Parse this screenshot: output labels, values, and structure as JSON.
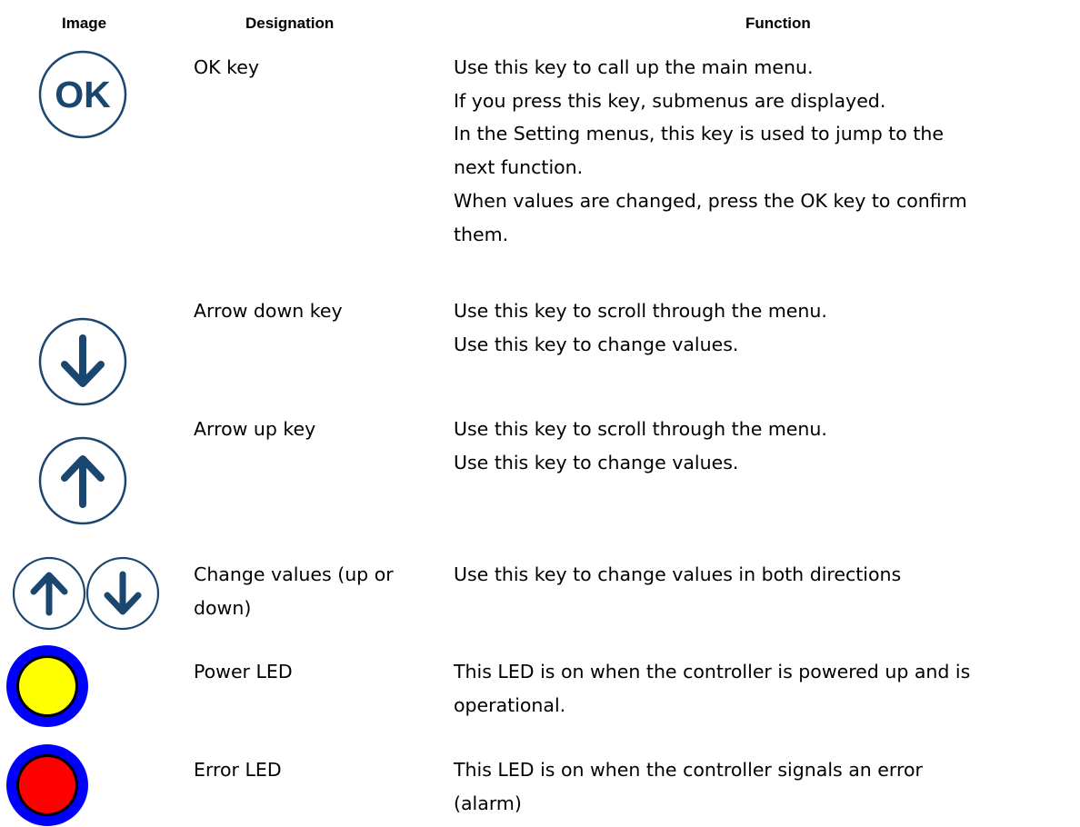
{
  "headers": {
    "image": "Image",
    "designation": "Designation",
    "function": "Function"
  },
  "rows": [
    {
      "icon": "ok-key-icon",
      "designation": [
        "OK key"
      ],
      "function": [
        "Use this key to call up the main menu.",
        "If you press this key, submenus are displayed.",
        "In the Setting menus, this key is used to jump to the",
        "next function.",
        "When values are changed, press the OK key to confirm",
        "them."
      ]
    },
    {
      "icon": "arrow-down-key-icon",
      "designation": [
        "Arrow down key"
      ],
      "function": [
        "Use this key to scroll through the menu.",
        "Use this key to change values."
      ]
    },
    {
      "icon": "arrow-up-key-icon",
      "designation": [
        "Arrow up key"
      ],
      "function": [
        "Use this key to scroll through the menu.",
        "Use this key to change values."
      ]
    },
    {
      "icon": "up-down-keys-icon",
      "designation": [
        "Change values (up or",
        "down)"
      ],
      "function": [
        "Use this key to change values in both directions"
      ]
    },
    {
      "icon": "power-led-icon",
      "designation": [
        "Power LED"
      ],
      "function": [
        "This LED is on when the controller is powered up and is",
        "operational."
      ]
    },
    {
      "icon": "error-led-icon",
      "designation": [
        "Error LED"
      ],
      "function": [
        "This LED is on when the controller signals an error",
        "(alarm)"
      ]
    }
  ],
  "icon_labels": {
    "ok": "OK"
  },
  "colors": {
    "key_blue": "#1b4670",
    "led_ring": "#0000ff",
    "power_led": "#ffff00",
    "error_led": "#ff0000"
  }
}
